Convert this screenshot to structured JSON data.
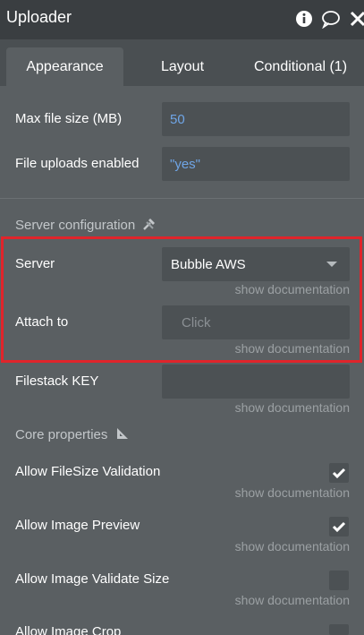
{
  "header": {
    "title": "Uploader"
  },
  "tabs": [
    {
      "label": "Appearance"
    },
    {
      "label": "Layout"
    },
    {
      "label": "Conditional (1)"
    }
  ],
  "fields": {
    "max_file_size": {
      "label": "Max file size (MB)",
      "value": "50"
    },
    "file_uploads_enabled": {
      "label": "File uploads enabled",
      "value": "\"yes\""
    }
  },
  "server_configuration": {
    "title": "Server configuration",
    "server": {
      "label": "Server",
      "value": "Bubble AWS"
    },
    "attach_to": {
      "label": "Attach to",
      "placeholder": "Click"
    },
    "filestack_key": {
      "label": "Filestack KEY",
      "value": ""
    }
  },
  "core_properties": {
    "title": "Core properties",
    "items": [
      {
        "label": "Allow FileSize Validation",
        "checked": true
      },
      {
        "label": "Allow Image Preview",
        "checked": true
      },
      {
        "label": "Allow Image Validate Size",
        "checked": false
      },
      {
        "label": "Allow Image Crop",
        "checked": false
      }
    ]
  },
  "show_documentation": "show documentation",
  "colors": {
    "highlight_border": "#e0242b",
    "value_text": "#6fa5e6",
    "panel_bg": "#5a5f62"
  }
}
